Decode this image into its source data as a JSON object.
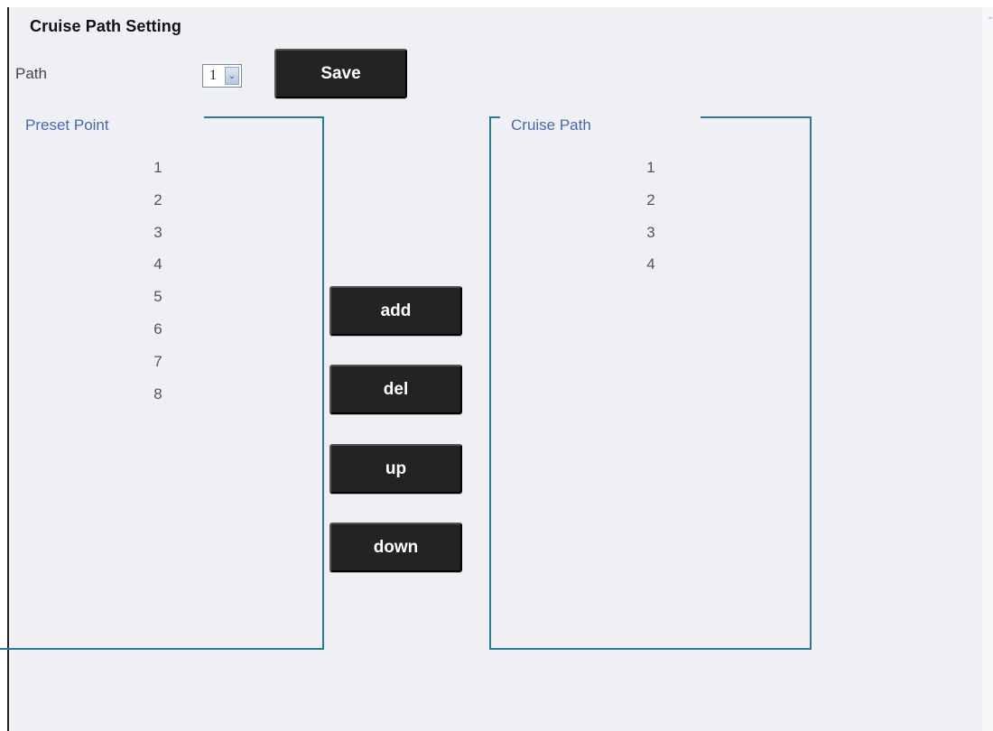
{
  "page": {
    "title": "Cruise Path Setting"
  },
  "controls": {
    "path_label": "Path",
    "path_selected": "1",
    "save_label": "Save"
  },
  "preset_panel": {
    "label": "Preset Point",
    "items": [
      "1",
      "2",
      "3",
      "4",
      "5",
      "6",
      "7",
      "8"
    ]
  },
  "cruise_panel": {
    "label": "Cruise Path",
    "items": [
      "1",
      "2",
      "3",
      "4"
    ]
  },
  "actions": {
    "add": "add",
    "del": "del",
    "up": "up",
    "down": "down"
  },
  "icons": {
    "select_arrow": "chevron-down-icon",
    "scroll_arrow": "scroll-up-icon"
  },
  "colors": {
    "background": "#eff0f4",
    "panel_border": "#2e7892",
    "panel_label": "#4b67a8",
    "button_bg": "#232323",
    "button_text": "#ffffff"
  }
}
